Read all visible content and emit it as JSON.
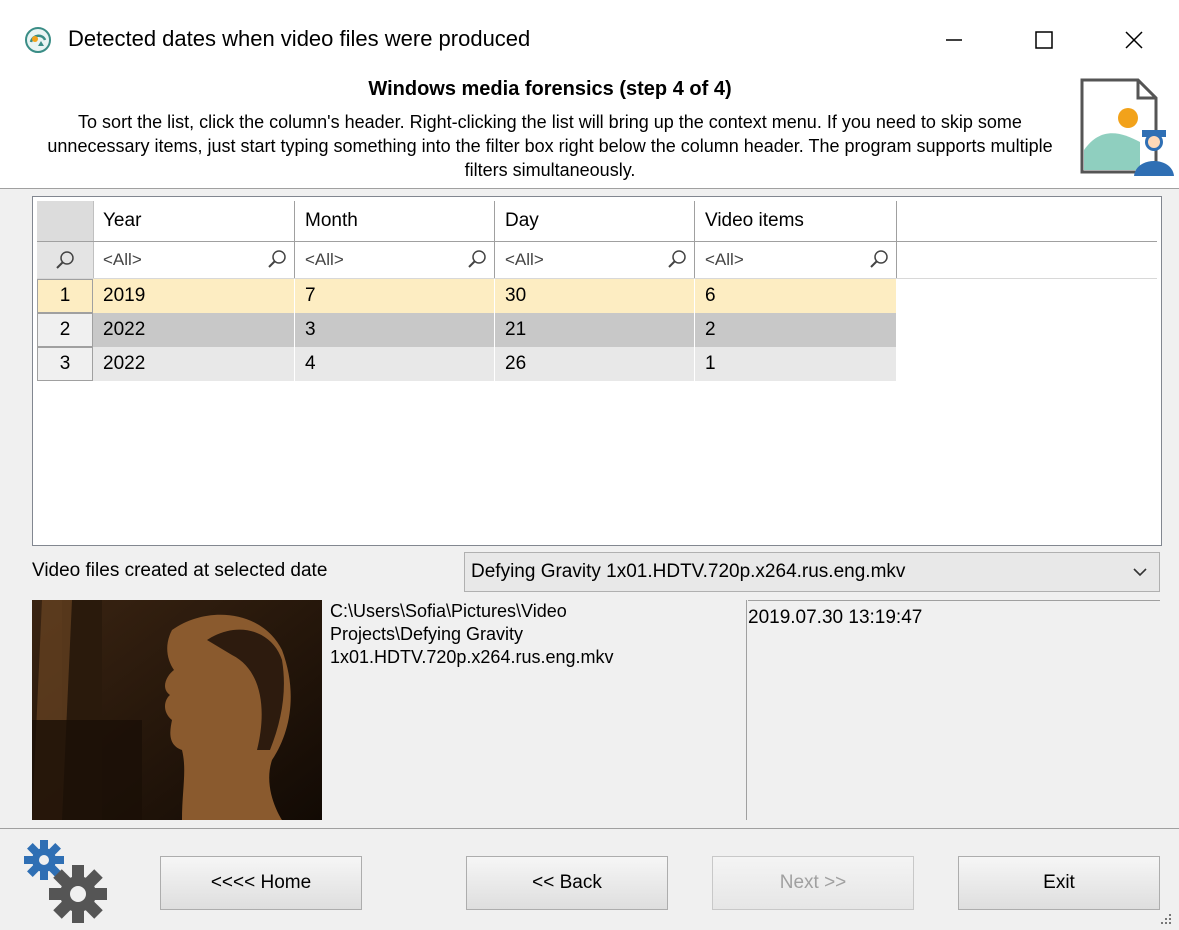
{
  "window": {
    "title": "Detected dates when video files were produced",
    "icon": "app-icon",
    "controls": {
      "minimize": "minimize-icon",
      "maximize": "maximize-icon",
      "close": "close-icon"
    }
  },
  "header": {
    "step_title": "Windows media forensics (step 4 of 4)",
    "instructions": "To sort the list, click the column's header. Right-clicking the list will bring up the context menu. If you need to skip some unnecessary items, just start typing something into the filter box right below the column header. The program supports multiple filters simultaneously."
  },
  "grid": {
    "columns": [
      "Year",
      "Month",
      "Day",
      "Video items"
    ],
    "filters": [
      "<All>",
      "<All>",
      "<All>",
      "<All>"
    ],
    "rows": [
      {
        "num": "1",
        "cells": [
          "2019",
          "7",
          "30",
          "6"
        ]
      },
      {
        "num": "2",
        "cells": [
          "2022",
          "3",
          "21",
          "2"
        ]
      },
      {
        "num": "3",
        "cells": [
          "2022",
          "4",
          "26",
          "1"
        ]
      }
    ]
  },
  "details": {
    "label": "Video files created at selected date",
    "selected_file": "Defying Gravity 1x01.HDTV.720p.x264.rus.eng.mkv",
    "path_lines": [
      "C:\\Users\\Sofia\\Pictures\\Video",
      "Projects\\Defying Gravity",
      "1x01.HDTV.720p.x264.rus.eng.mkv"
    ],
    "date": "2019.07.30 13:19:47"
  },
  "buttons": {
    "home_label": "<<<< Home",
    "back_label": "<< Back",
    "next_label": "Next >>",
    "exit_label": "Exit"
  },
  "colors": {
    "selected_row": "#fdedc2",
    "alt_row": "#c8c8c8",
    "row_three": "#e8e8e8"
  }
}
